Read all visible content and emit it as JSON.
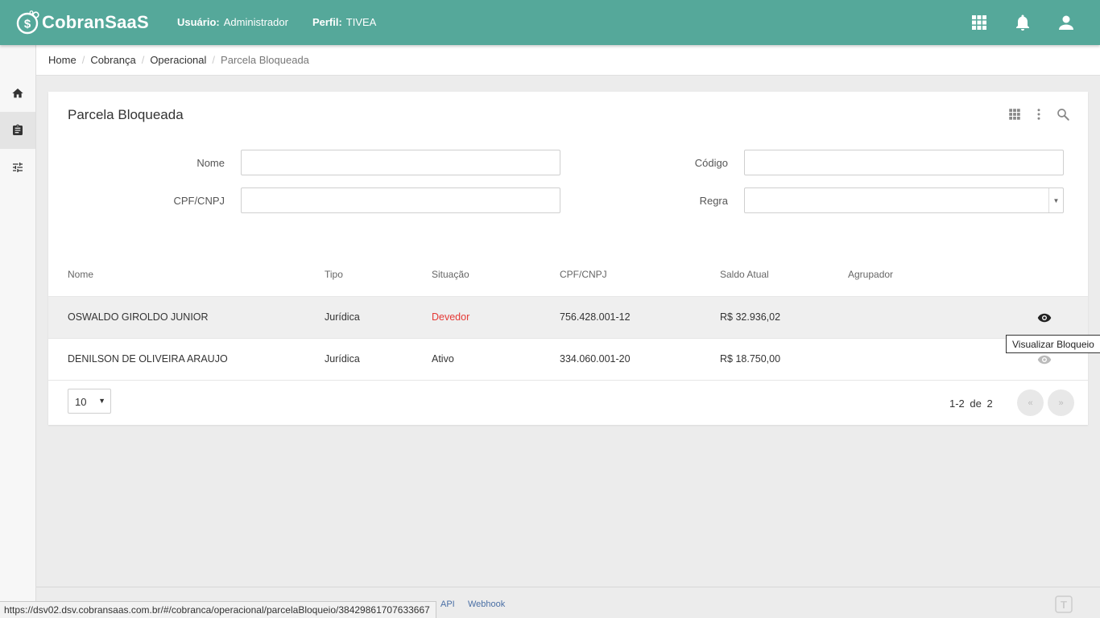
{
  "app": {
    "name": "CobranSaaS"
  },
  "header": {
    "user_label": "Usuário:",
    "user_value": "Administrador",
    "profile_label": "Perfil:",
    "profile_value": "TIVEA"
  },
  "breadcrumb": [
    "Home",
    "Cobrança",
    "Operacional",
    "Parcela Bloqueada"
  ],
  "page": {
    "title": "Parcela Bloqueada"
  },
  "filters": {
    "nome_label": "Nome",
    "nome_value": "",
    "codigo_label": "Código",
    "codigo_value": "",
    "cpf_label": "CPF/CNPJ",
    "cpf_value": "",
    "regra_label": "Regra",
    "regra_value": ""
  },
  "table": {
    "headers": [
      "Nome",
      "Tipo",
      "Situação",
      "CPF/CNPJ",
      "Saldo Atual",
      "Agrupador"
    ],
    "rows": [
      {
        "nome": "OSWALDO GIROLDO JUNIOR",
        "tipo": "Jurídica",
        "situacao": "Devedor",
        "cpf": "756.428.001-12",
        "saldo": "R$ 32.936,02",
        "agrupador": ""
      },
      {
        "nome": "DENILSON DE OLIVEIRA ARAUJO",
        "tipo": "Jurídica",
        "situacao": "Ativo",
        "cpf": "334.060.001-20",
        "saldo": "R$ 18.750,00",
        "agrupador": ""
      }
    ]
  },
  "tooltip": "Visualizar Bloqueio",
  "pagination": {
    "page_size": "10",
    "range": "1-2",
    "of": "de",
    "total": "2",
    "prev": "«",
    "next": "»"
  },
  "footer": {
    "links": [
      "API",
      "Webhook"
    ]
  },
  "status_url": "https://dsv02.dsv.cobransaas.com.br/#/cobranca/operacional/parcelaBloqueio/38429861707633667",
  "colors": {
    "primary": "#55a89a",
    "danger": "#e53935"
  }
}
